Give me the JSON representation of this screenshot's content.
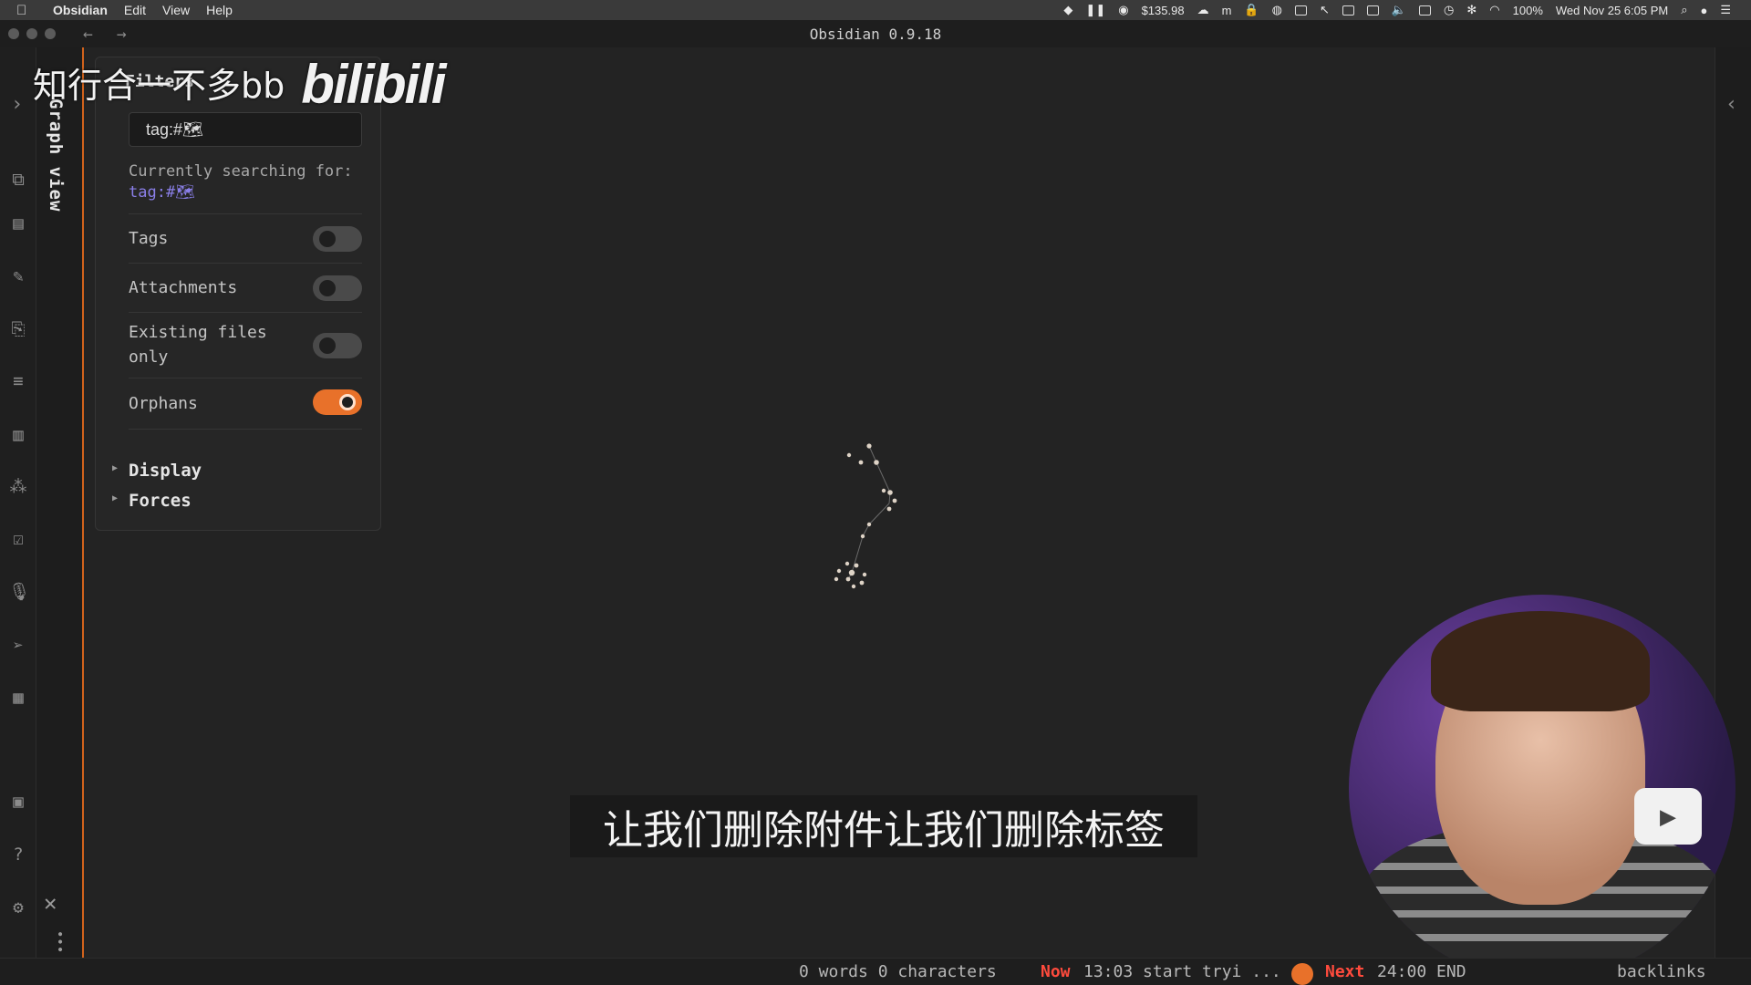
{
  "menubar": {
    "app": "Obsidian",
    "items": [
      "Edit",
      "View",
      "Help"
    ],
    "money": "$135.98",
    "battery": "100%",
    "datetime": "Wed Nov 25  6:05 PM"
  },
  "window": {
    "title": "Obsidian 0.9.18",
    "back": "←",
    "forward": "→"
  },
  "sidebar": {
    "tab_title": "Graph view"
  },
  "filters": {
    "title": "Filters",
    "search_value": "tag:#🗺",
    "currently_label": "Currently searching for:",
    "currently_value": "tag:#🗺",
    "rows": [
      {
        "label": "Tags",
        "on": false
      },
      {
        "label": "Attachments",
        "on": false
      },
      {
        "label": "Existing files only",
        "label_line1": "Existing files",
        "label_line2": "only",
        "on": false
      },
      {
        "label": "Orphans",
        "on": true
      }
    ],
    "sections": [
      "Display",
      "Forces"
    ]
  },
  "overlay": {
    "watermark": "知行合一不多bb",
    "watermark_logo": "bilibili",
    "subtitle": "让我们删除附件让我们删除标签"
  },
  "status": {
    "counts": "0 words 0 characters",
    "now_label": "Now",
    "now_text": "13:03 start tryi ...",
    "next_label": "Next",
    "next_text": "24:00 END",
    "backlinks": "backlinks"
  },
  "colors": {
    "accent": "#e8712a",
    "tag_text": "#8a7fe8",
    "status_alert": "#ff4b3d"
  }
}
